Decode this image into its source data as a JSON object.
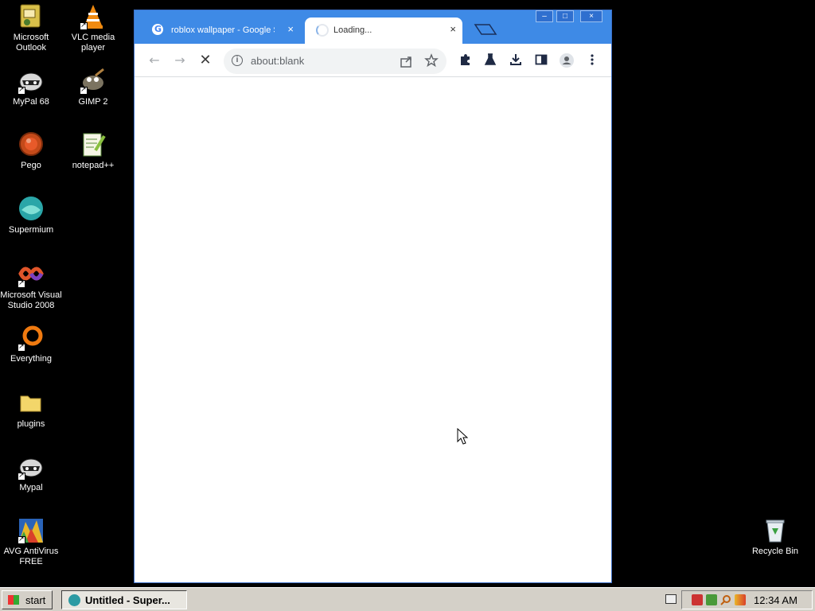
{
  "desktop": {
    "icons": [
      {
        "label": "Microsoft Outlook",
        "icon": "outlook-icon"
      },
      {
        "label": "VLC media player",
        "icon": "vlc-icon"
      },
      {
        "label": "MyPal 68",
        "icon": "mypal-icon"
      },
      {
        "label": "GIMP 2",
        "icon": "gimp-icon"
      },
      {
        "label": "Pego",
        "icon": "pego-icon"
      },
      {
        "label": "notepad++",
        "icon": "notepadpp-icon"
      },
      {
        "label": "Supermium",
        "icon": "supermium-icon"
      },
      {
        "label": "Microsoft Visual Studio 2008",
        "icon": "visual-studio-icon"
      },
      {
        "label": "Everything",
        "icon": "everything-icon"
      },
      {
        "label": "plugins",
        "icon": "folder-icon"
      },
      {
        "label": "Mypal",
        "icon": "mypal-icon"
      },
      {
        "label": "AVG AntiVirus FREE",
        "icon": "avg-icon"
      },
      {
        "label": "Recycle Bin",
        "icon": "recycle-bin-icon"
      }
    ]
  },
  "browser": {
    "tabs": [
      {
        "title": "roblox wallpaper - Google Se",
        "close": "×"
      },
      {
        "title": "Loading...",
        "close": "×"
      }
    ],
    "window_controls": {
      "minimize": "–",
      "maximize": "□",
      "close": "×"
    },
    "address": {
      "url": "about:blank"
    },
    "accent": "#3e8ae6"
  },
  "taskbar": {
    "start_label": "start",
    "task_button_label": "Untitled - Super...",
    "clock": "12:34 AM"
  }
}
